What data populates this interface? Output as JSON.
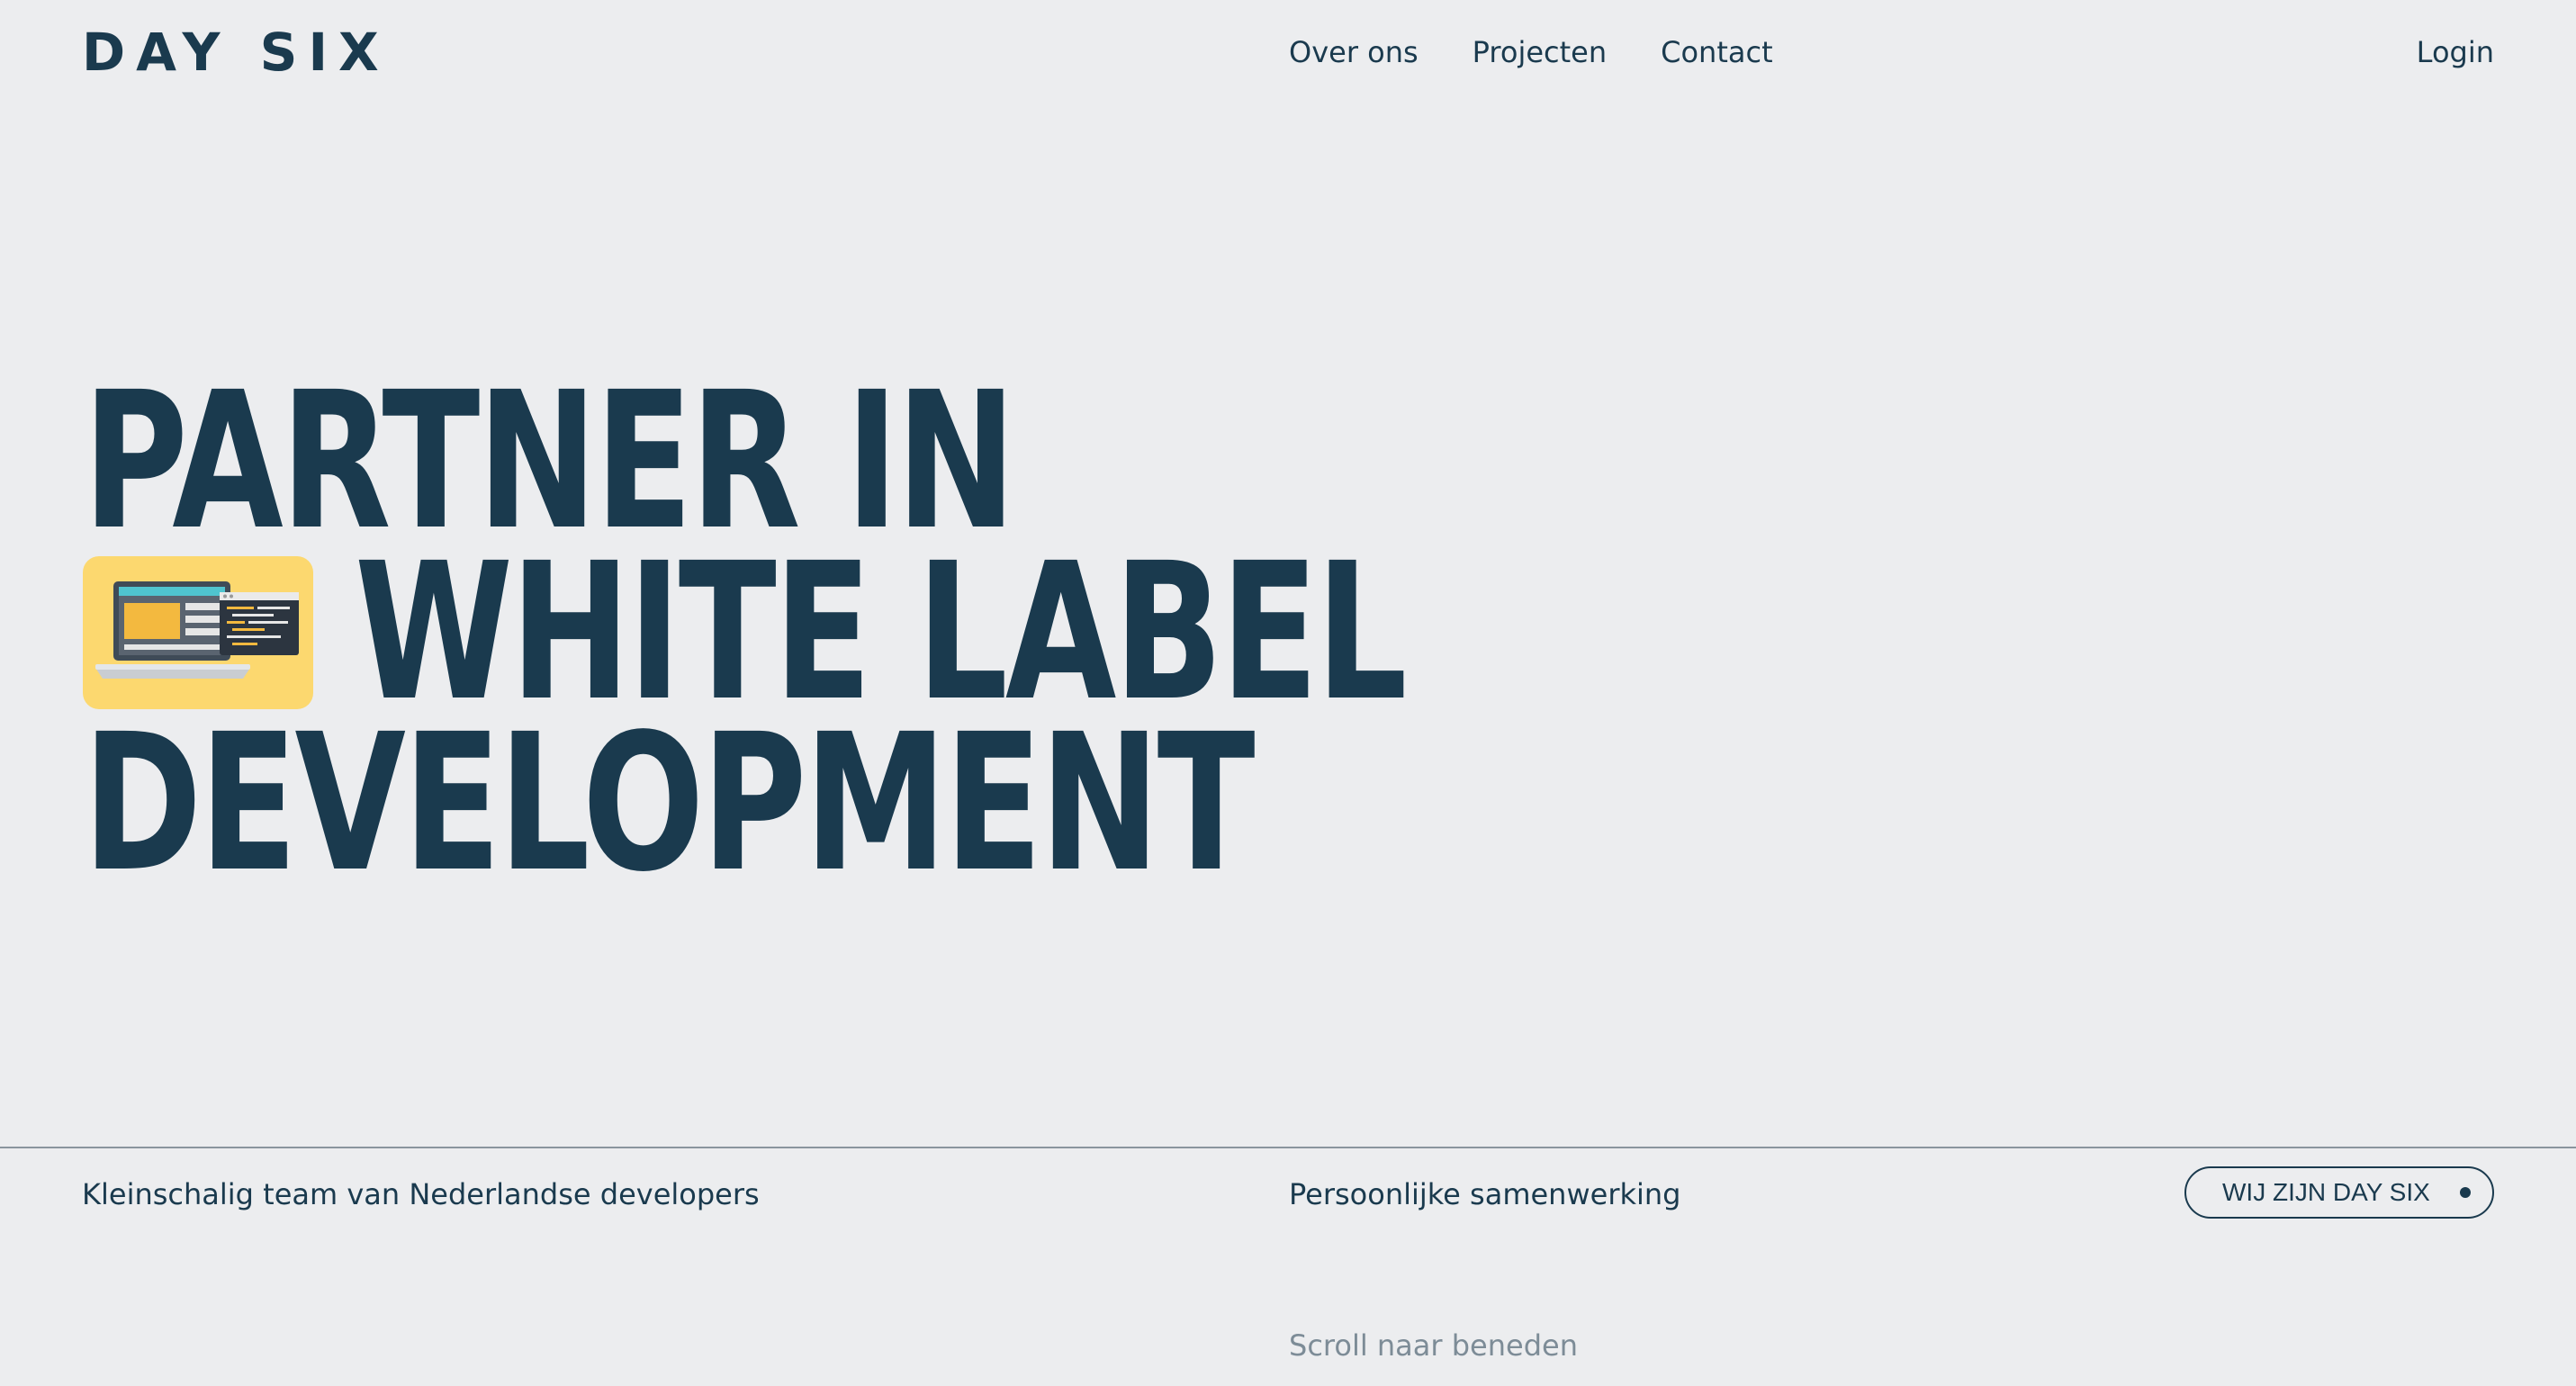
{
  "brand": {
    "logo_text": "DAY SIX"
  },
  "nav": {
    "items": [
      {
        "label": "Over ons"
      },
      {
        "label": "Projecten"
      },
      {
        "label": "Contact"
      }
    ],
    "login_label": "Login"
  },
  "hero": {
    "line1": "PARTNER IN",
    "line2": "WHITE LABEL",
    "line3": "DEVELOPMENT",
    "icon": "laptop-code-icon"
  },
  "footer": {
    "left_text": "Kleinschalig team van Nederlandse developers",
    "middle_text": "Persoonlijke samenwerking",
    "cta_label": "WIJ ZIJN DAY SIX",
    "scroll_hint": "Scroll naar beneden"
  },
  "colors": {
    "background": "#ecedef",
    "primary": "#1a3a4e",
    "icon_background": "#fcd86f",
    "muted_text": "#7d8c97",
    "divider": "#8a959e"
  }
}
